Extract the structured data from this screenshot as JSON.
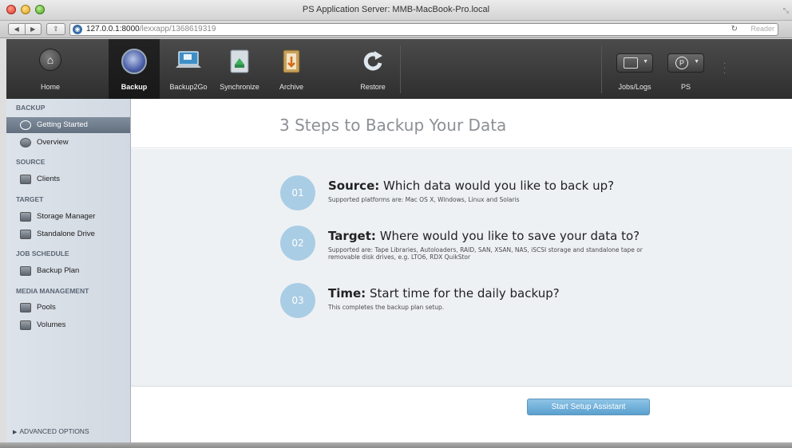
{
  "window": {
    "title": "PS Application Server: MMB-MacBook-Pro.local"
  },
  "browser": {
    "url_host": "127.0.0.1:8000",
    "url_path": "/lexxapp/1368619319",
    "reader_label": "Reader",
    "reload_glyph": "↻"
  },
  "toolbar": {
    "items": [
      {
        "label": "Home",
        "icon": "home-icon"
      },
      {
        "label": "Backup",
        "icon": "backup-icon"
      },
      {
        "label": "Backup2Go",
        "icon": "laptop-icon"
      },
      {
        "label": "Synchronize",
        "icon": "synchronize-icon"
      },
      {
        "label": "Archive",
        "icon": "archive-icon"
      },
      {
        "label": "Restore",
        "icon": "restore-icon"
      }
    ],
    "jobs_label": "Jobs/Logs",
    "ps_label": "PS",
    "ps_glyph": "P"
  },
  "sidebar": {
    "sections": {
      "backup": "BACKUP",
      "source": "SOURCE",
      "target": "TARGET",
      "job_schedule": "JOB SCHEDULE",
      "media_management": "MEDIA MANAGEMENT"
    },
    "items": {
      "getting_started": "Getting Started",
      "overview": "Overview",
      "clients": "Clients",
      "storage_manager": "Storage Manager",
      "standalone_drive": "Standalone Drive",
      "backup_plan": "Backup Plan",
      "pools": "Pools",
      "volumes": "Volumes"
    },
    "advanced_options": "ADVANCED OPTIONS"
  },
  "main": {
    "title": "3 Steps to Backup Your Data",
    "steps": [
      {
        "number": "01",
        "keyword": "Source:",
        "question": "Which data would you like to back up?",
        "desc": "Supported platforms are: Mac OS X, Windows, Linux and Solaris"
      },
      {
        "number": "02",
        "keyword": "Target:",
        "question": "Where would you like to save your data to?",
        "desc": "Supported are: Tape Libraries, Autoloaders, RAID, SAN, XSAN, NAS, iSCSI storage and standalone tape or removable disk drives, e.g. LTO6, RDX QuikStor"
      },
      {
        "number": "03",
        "keyword": "Time:",
        "question": "Start time for the daily backup?",
        "desc": "This completes the backup plan setup."
      }
    ],
    "start_button": "Start Setup Assistant"
  }
}
